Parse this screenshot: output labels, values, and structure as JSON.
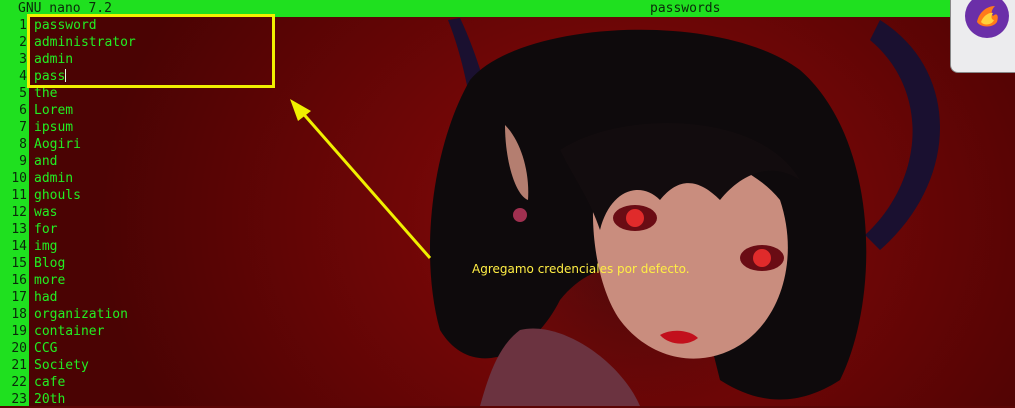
{
  "titlebar": {
    "app_title": "GNU nano 7.2",
    "file_name": "passwords"
  },
  "editor": {
    "lines": [
      {
        "number": "1",
        "text": "password"
      },
      {
        "number": "2",
        "text": "administrator"
      },
      {
        "number": "3",
        "text": "admin"
      },
      {
        "number": "4",
        "text": "pass"
      },
      {
        "number": "5",
        "text": "the"
      },
      {
        "number": "6",
        "text": "Lorem"
      },
      {
        "number": "7",
        "text": "ipsum"
      },
      {
        "number": "8",
        "text": "Aogiri"
      },
      {
        "number": "9",
        "text": "and"
      },
      {
        "number": "10",
        "text": "admin"
      },
      {
        "number": "11",
        "text": "ghouls"
      },
      {
        "number": "12",
        "text": "was"
      },
      {
        "number": "13",
        "text": "for"
      },
      {
        "number": "14",
        "text": "img"
      },
      {
        "number": "15",
        "text": "Blog"
      },
      {
        "number": "16",
        "text": "more"
      },
      {
        "number": "17",
        "text": "had"
      },
      {
        "number": "18",
        "text": "organization"
      },
      {
        "number": "19",
        "text": "container"
      },
      {
        "number": "20",
        "text": "CCG"
      },
      {
        "number": "21",
        "text": "Society"
      },
      {
        "number": "22",
        "text": "cafe"
      },
      {
        "number": "23",
        "text": "20th"
      }
    ]
  },
  "annotation": {
    "text": "Agregamo credenciales por defecto."
  },
  "dock": {
    "icon": "firefox-icon"
  },
  "colors": {
    "nano_green": "#1fe01f",
    "highlight_yellow": "#f0f000",
    "background_red": "#6e0606"
  }
}
